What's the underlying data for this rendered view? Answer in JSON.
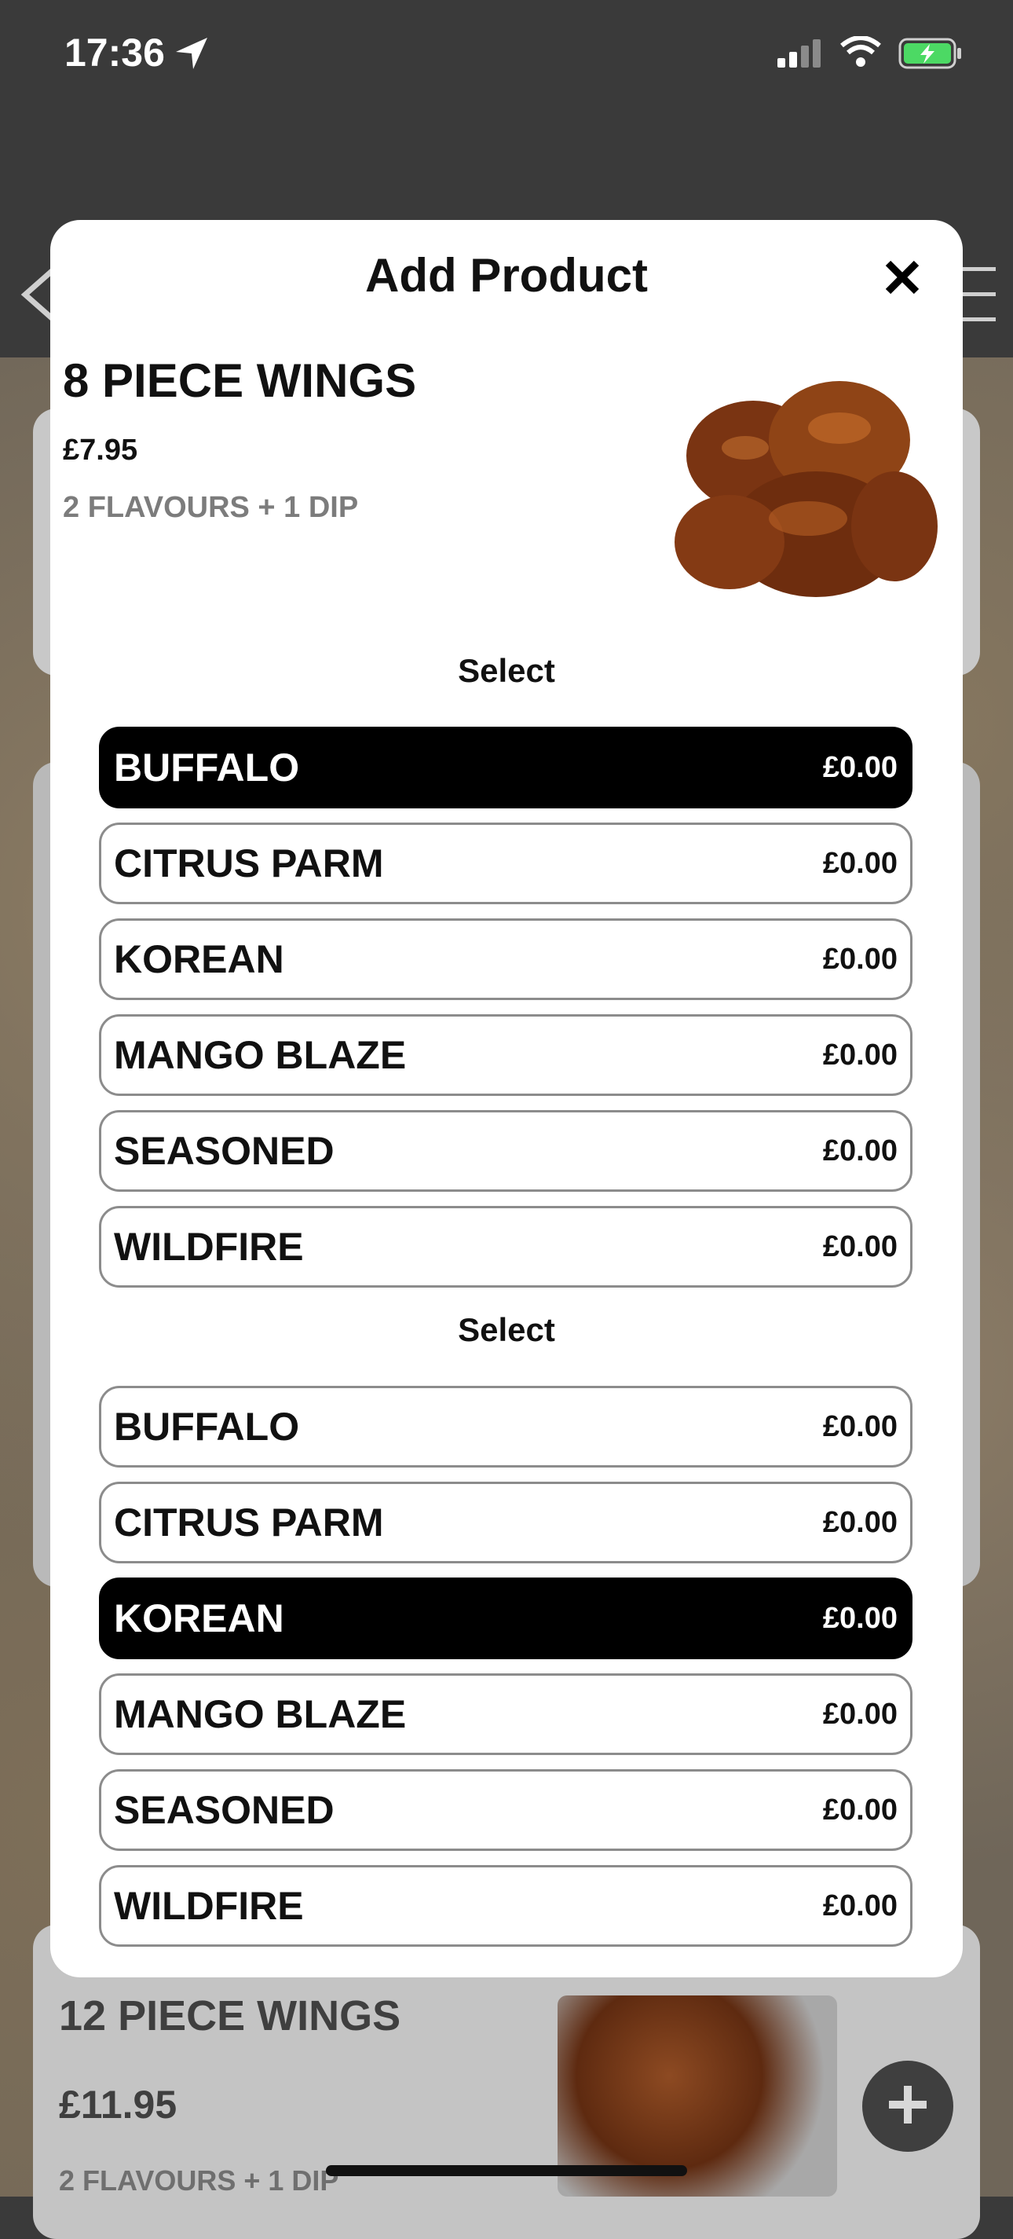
{
  "status_bar": {
    "time": "17:36"
  },
  "background": {
    "product_title": "12 PIECE WINGS",
    "product_price": "£11.95",
    "product_desc": "2 FLAVOURS + 1 DIP"
  },
  "modal": {
    "title": "Add Product",
    "product": {
      "name": "8 PIECE WINGS",
      "price": "£7.95",
      "description": "2 FLAVOURS + 1 DIP"
    },
    "groups": [
      {
        "label": "Select",
        "options": [
          {
            "name": "BUFFALO",
            "price": "£0.00",
            "selected": true
          },
          {
            "name": "CITRUS PARM",
            "price": "£0.00",
            "selected": false
          },
          {
            "name": "KOREAN",
            "price": "£0.00",
            "selected": false
          },
          {
            "name": "MANGO BLAZE",
            "price": "£0.00",
            "selected": false
          },
          {
            "name": "SEASONED",
            "price": "£0.00",
            "selected": false
          },
          {
            "name": "WILDFIRE",
            "price": "£0.00",
            "selected": false
          }
        ]
      },
      {
        "label": "Select",
        "options": [
          {
            "name": "BUFFALO",
            "price": "£0.00",
            "selected": false
          },
          {
            "name": "CITRUS PARM",
            "price": "£0.00",
            "selected": false
          },
          {
            "name": "KOREAN",
            "price": "£0.00",
            "selected": true
          },
          {
            "name": "MANGO BLAZE",
            "price": "£0.00",
            "selected": false
          },
          {
            "name": "SEASONED",
            "price": "£0.00",
            "selected": false
          },
          {
            "name": "WILDFIRE",
            "price": "£0.00",
            "selected": false
          }
        ]
      }
    ]
  },
  "icons": [
    "location-arrow-icon",
    "signal-icon",
    "wifi-icon",
    "battery-charging-icon",
    "back-chevron-icon",
    "hamburger-menu-icon",
    "close-icon",
    "plus-icon"
  ],
  "colors": {
    "selected_bg": "#000000",
    "option_border": "#8c8c8c",
    "battery_green": "#4cd964"
  }
}
